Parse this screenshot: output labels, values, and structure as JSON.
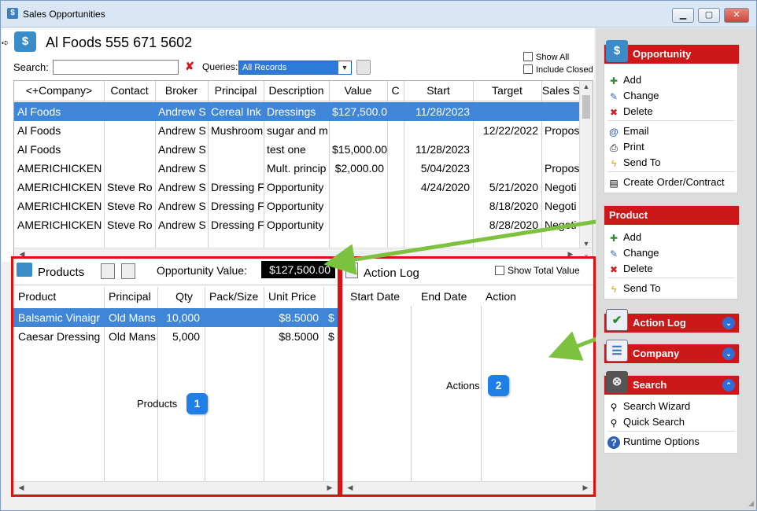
{
  "window": {
    "title": "Sales Opportunities",
    "minimize": "▁",
    "maximize": "▢",
    "close": "✕"
  },
  "header": {
    "company_title": "Al Foods 555 671 5602",
    "search_label": "Search:",
    "search_value": "",
    "queries_label": "Queries:",
    "queries_value": "All Records",
    "show_all_label": "Show All",
    "include_closed_label": "Include Closed"
  },
  "grid": {
    "columns": [
      "<+Company>",
      "Contact",
      "Broker",
      "Principal",
      "Description",
      "Value",
      "C",
      "Start",
      "Target",
      "Sales S"
    ],
    "rows": [
      [
        "Al Foods",
        "",
        "Andrew S",
        "Cereal Ink",
        "Dressings",
        "$127,500.00",
        "",
        "11/28/2023",
        "",
        ""
      ],
      [
        "Al Foods",
        "",
        "Andrew S",
        "Mushroom",
        "sugar and m",
        "",
        "",
        "",
        "12/22/2022",
        "Propos"
      ],
      [
        "Al Foods",
        "",
        "Andrew S",
        "",
        "test one",
        "$15,000.00",
        "",
        "11/28/2023",
        "",
        ""
      ],
      [
        "AMERICHICKEN",
        "",
        "Andrew S",
        "",
        "Mult. princip",
        "$2,000.00",
        "",
        "5/04/2023",
        "",
        "Propos"
      ],
      [
        "AMERICHICKEN",
        "Steve Ro",
        "Andrew S",
        "Dressing F",
        "Opportunity",
        "",
        "",
        "4/24/2020",
        "5/21/2020",
        "Negoti"
      ],
      [
        "AMERICHICKEN",
        "Steve Ro",
        "Andrew S",
        "Dressing F",
        "Opportunity",
        "",
        "",
        "",
        "8/18/2020",
        "Negoti"
      ],
      [
        "AMERICHICKEN",
        "Steve Ro",
        "Andrew S",
        "Dressing F",
        "Opportunity",
        "",
        "",
        "",
        "8/28/2020",
        "Negoti"
      ]
    ]
  },
  "products": {
    "title": "Products",
    "opportunity_value_label": "Opportunity Value:",
    "opportunity_value": "$127,500.00",
    "columns": [
      "Product",
      "Principal",
      "Qty",
      "Pack/Size",
      "Unit Price"
    ],
    "rows": [
      [
        "Balsamic Vinaigr",
        "Old Mans",
        "10,000",
        "",
        "$8.5000",
        "$"
      ],
      [
        "Caesar Dressing",
        "Old Mans",
        "5,000",
        "",
        "$8.5000",
        "$"
      ]
    ],
    "callout_label": "Products",
    "callout_number": "1"
  },
  "action_log": {
    "title": "Action Log",
    "show_total_label": "Show Total Value",
    "columns": [
      "Start Date",
      "End Date",
      "Action"
    ],
    "callout_label": "Actions",
    "callout_number": "2"
  },
  "sidebar": {
    "opportunity": {
      "title": "Opportunity",
      "items": [
        "Add",
        "Change",
        "Delete",
        "Email",
        "Print",
        "Send To",
        "Create Order/Contract"
      ]
    },
    "product": {
      "title": "Product",
      "items": [
        "Add",
        "Change",
        "Delete",
        "Send To"
      ]
    },
    "action_log": {
      "title": "Action Log"
    },
    "company": {
      "title": "Company"
    },
    "search": {
      "title": "Search",
      "items": [
        "Search Wizard",
        "Quick Search",
        "Runtime Options"
      ]
    }
  },
  "colors": {
    "accent_red": "#cc1818",
    "selection_blue": "#3f86d9",
    "callout_blue": "#1e7fe6",
    "arrow_green": "#7cc23f"
  }
}
